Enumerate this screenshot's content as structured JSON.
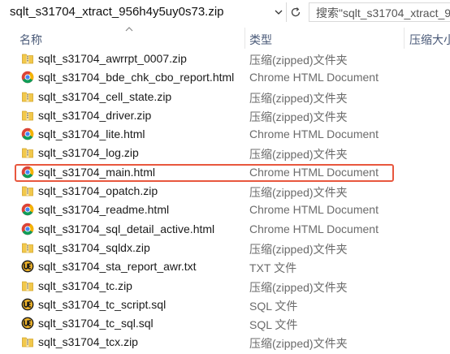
{
  "address": {
    "path": "sqlt_s31704_xtract_956h4y5uy0s73.zip",
    "search_placeholder": "搜索\"sqlt_s31704_xtract_956"
  },
  "columns": {
    "name": "名称",
    "type": "类型",
    "size": "压缩大小"
  },
  "files": [
    {
      "name": "sqlt_s31704_awrrpt_0007.zip",
      "type": "压缩(zipped)文件夹",
      "icon": "zip-folder-icon"
    },
    {
      "name": "sqlt_s31704_bde_chk_cbo_report.html",
      "type": "Chrome HTML Document",
      "icon": "chrome-icon"
    },
    {
      "name": "sqlt_s31704_cell_state.zip",
      "type": "压缩(zipped)文件夹",
      "icon": "zip-folder-icon"
    },
    {
      "name": "sqlt_s31704_driver.zip",
      "type": "压缩(zipped)文件夹",
      "icon": "zip-folder-icon"
    },
    {
      "name": "sqlt_s31704_lite.html",
      "type": "Chrome HTML Document",
      "icon": "chrome-icon"
    },
    {
      "name": "sqlt_s31704_log.zip",
      "type": "压缩(zipped)文件夹",
      "icon": "zip-folder-icon"
    },
    {
      "name": "sqlt_s31704_main.html",
      "type": "Chrome HTML Document",
      "icon": "chrome-icon"
    },
    {
      "name": "sqlt_s31704_opatch.zip",
      "type": "压缩(zipped)文件夹",
      "icon": "zip-folder-icon"
    },
    {
      "name": "sqlt_s31704_readme.html",
      "type": "Chrome HTML Document",
      "icon": "chrome-icon"
    },
    {
      "name": "sqlt_s31704_sql_detail_active.html",
      "type": "Chrome HTML Document",
      "icon": "chrome-icon"
    },
    {
      "name": "sqlt_s31704_sqldx.zip",
      "type": "压缩(zipped)文件夹",
      "icon": "zip-folder-icon"
    },
    {
      "name": "sqlt_s31704_sta_report_awr.txt",
      "type": "TXT 文件",
      "icon": "ultraedit-icon"
    },
    {
      "name": "sqlt_s31704_tc.zip",
      "type": "压缩(zipped)文件夹",
      "icon": "zip-folder-icon"
    },
    {
      "name": "sqlt_s31704_tc_script.sql",
      "type": "SQL 文件",
      "icon": "ultraedit-icon"
    },
    {
      "name": "sqlt_s31704_tc_sql.sql",
      "type": "SQL 文件",
      "icon": "ultraedit-icon"
    },
    {
      "name": "sqlt_s31704_tcx.zip",
      "type": "压缩(zipped)文件夹",
      "icon": "zip-folder-icon"
    }
  ],
  "colors": {
    "highlight": "#e8573e",
    "header_text": "#4a5a78"
  }
}
